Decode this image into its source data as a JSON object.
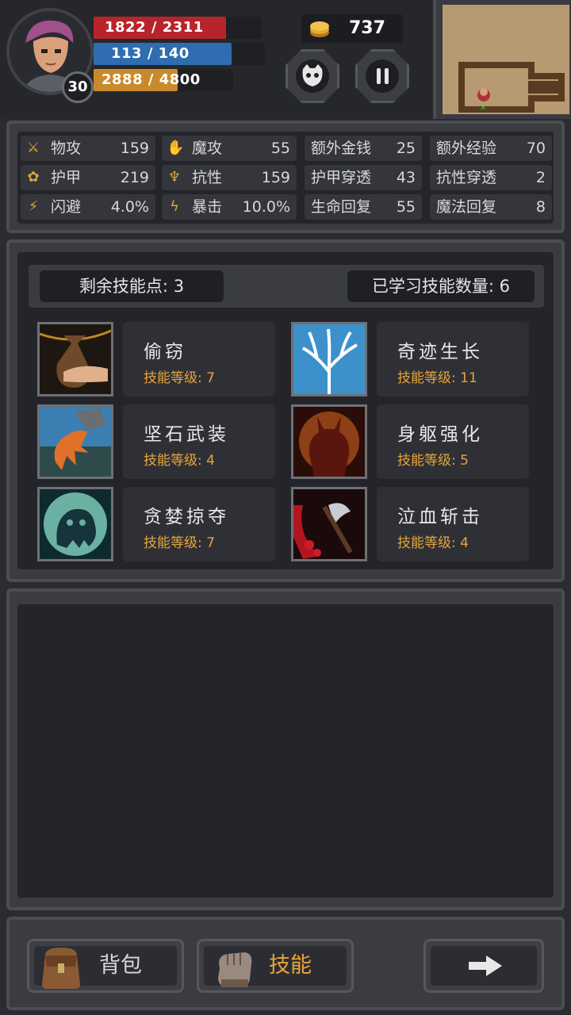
{
  "hud": {
    "level": "30",
    "hp_text": "1822 / 2311",
    "hp_fraction": 0.788,
    "mp_text": "113 / 140",
    "mp_fraction": 0.807,
    "xp_text": "2888 / 4800",
    "xp_fraction": 0.6,
    "gold": "737",
    "hp_color": "#b8242b",
    "mp_color": "#2f6db0",
    "xp_color": "#c98a2b"
  },
  "stats": [
    {
      "icon": "sword-icon",
      "label": "物攻",
      "value": "159"
    },
    {
      "icon": "magic-hand-icon",
      "label": "魔攻",
      "value": "55"
    },
    {
      "icon": "",
      "label": "额外金钱",
      "value": "25"
    },
    {
      "icon": "",
      "label": "额外经验",
      "value": "70"
    },
    {
      "icon": "paw-icon",
      "label": "护甲",
      "value": "219"
    },
    {
      "icon": "muscle-icon",
      "label": "抗性",
      "value": "159"
    },
    {
      "icon": "",
      "label": "护甲穿透",
      "value": "43"
    },
    {
      "icon": "",
      "label": "抗性穿透",
      "value": "2"
    },
    {
      "icon": "runner-icon",
      "label": "闪避",
      "value": "4.0%"
    },
    {
      "icon": "lightning-icon",
      "label": "暴击",
      "value": "10.0%"
    },
    {
      "icon": "",
      "label": "生命回复",
      "value": "55"
    },
    {
      "icon": "",
      "label": "魔法回复",
      "value": "8"
    }
  ],
  "skills_header": {
    "remaining_points": "剩余技能点: 3",
    "learned_count": "已学习技能数量: 6"
  },
  "skills": [
    {
      "name": "偷窃",
      "level": "技能等级: 7",
      "icon": "money-bag-icon"
    },
    {
      "name": "奇迹生长",
      "level": "技能等级: 11",
      "icon": "tree-icon"
    },
    {
      "name": "坚石武装",
      "level": "技能等级: 4",
      "icon": "stone-claw-icon"
    },
    {
      "name": "身躯强化",
      "level": "技能等级: 5",
      "icon": "demon-body-icon"
    },
    {
      "name": "贪婪掠夺",
      "level": "技能等级: 7",
      "icon": "ghost-icon"
    },
    {
      "name": "泣血斩击",
      "level": "技能等级: 4",
      "icon": "blood-axe-icon"
    }
  ],
  "nav": {
    "bag": "背包",
    "skills": "技能",
    "active_color": "#e8a53a"
  }
}
